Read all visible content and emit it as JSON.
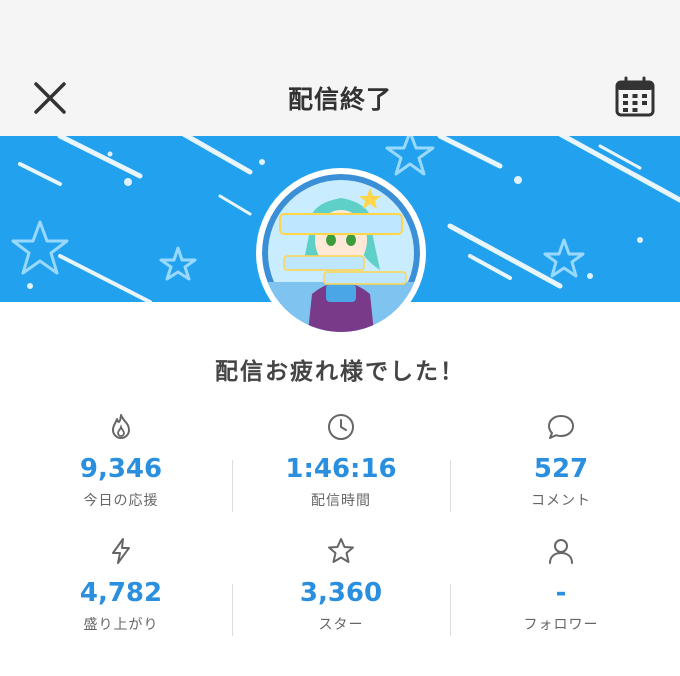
{
  "header": {
    "title": "配信終了"
  },
  "banner": {
    "color": "#22a2ee"
  },
  "message": "配信お疲れ様でした！",
  "stats": [
    {
      "icon": "fire-icon",
      "value": "9,346",
      "label": "今日の応援"
    },
    {
      "icon": "clock-icon",
      "value": "1:46:16",
      "label": "配信時間"
    },
    {
      "icon": "comment-icon",
      "value": "527",
      "label": "コメント"
    },
    {
      "icon": "bolt-icon",
      "value": "4,782",
      "label": "盛り上がり"
    },
    {
      "icon": "star-icon",
      "value": "3,360",
      "label": "スター"
    },
    {
      "icon": "person-icon",
      "value": "-",
      "label": "フォロワー"
    }
  ],
  "colors": {
    "accent": "#2b8fe0",
    "banner": "#22a2ee",
    "header_bg": "#f5f5f5"
  }
}
